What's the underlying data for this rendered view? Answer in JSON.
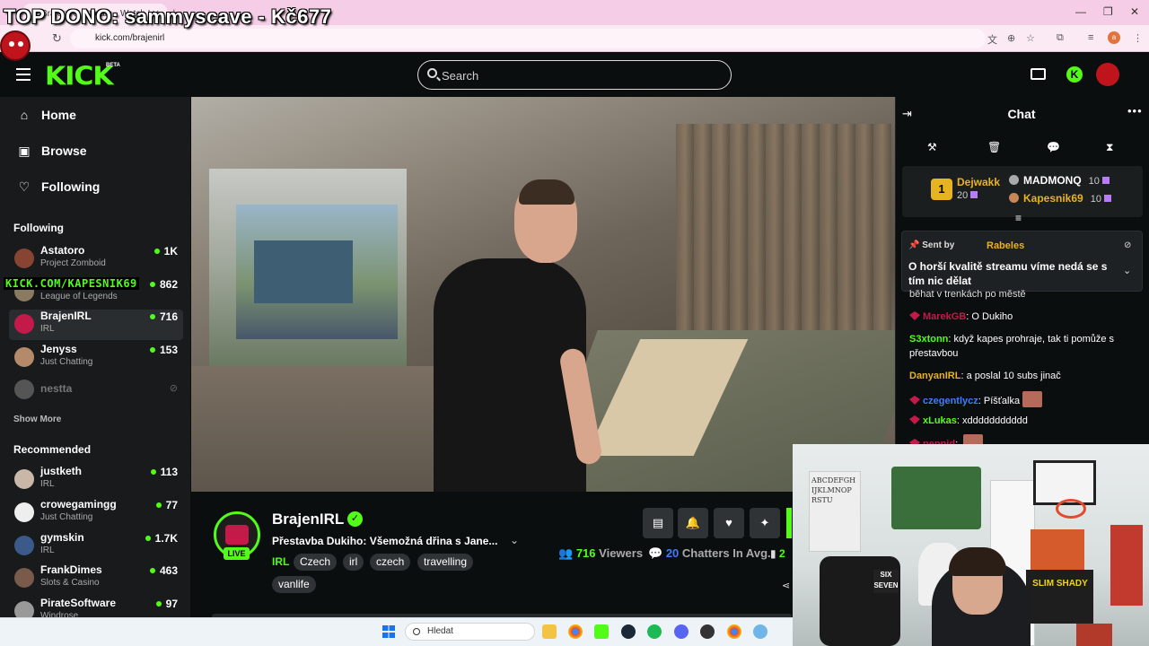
{
  "overlay": {
    "top_donor_text": "TOP DONO: sammyscave - Kč677",
    "watermark": "KICK.COM/KAPESNIK69"
  },
  "browser": {
    "tab_title": "BrajenIRL Stream - Watch L...",
    "url": "kick.com/brajenirl",
    "profile_initial": "a"
  },
  "header": {
    "logo": "KICK",
    "beta": "BETA",
    "search_placeholder": "Search"
  },
  "sidebar": {
    "nav": [
      {
        "label": "Home",
        "icon": "home-icon"
      },
      {
        "label": "Browse",
        "icon": "browse-icon"
      },
      {
        "label": "Following",
        "icon": "heart-icon"
      }
    ],
    "following_heading": "Following",
    "following": [
      {
        "name": "Astatoro",
        "category": "Project Zomboid",
        "viewers": "1K"
      },
      {
        "name": "",
        "category": "League of Legends",
        "viewers": "862"
      },
      {
        "name": "BrajenIRL",
        "category": "IRL",
        "viewers": "716"
      },
      {
        "name": "Jenyss",
        "category": "Just Chatting",
        "viewers": "153"
      },
      {
        "name": "nestta",
        "category": "",
        "viewers": ""
      }
    ],
    "show_more": "Show More",
    "recommended_heading": "Recommended",
    "recommended": [
      {
        "name": "justketh",
        "category": "IRL",
        "viewers": "113"
      },
      {
        "name": "crowegamingg",
        "category": "Just Chatting",
        "viewers": "77"
      },
      {
        "name": "gymskin",
        "category": "IRL",
        "viewers": "1.7K"
      },
      {
        "name": "FrankDimes",
        "category": "Slots & Casino",
        "viewers": "463"
      },
      {
        "name": "PirateSoftware",
        "category": "Windrose",
        "viewers": "97"
      }
    ]
  },
  "stream": {
    "channel": "BrajenIRL",
    "live": "LIVE",
    "title": "Přestavba Dukiho: Všemožná dřina s Jane...",
    "category": "IRL",
    "tags": [
      "Czech",
      "irl",
      "czech",
      "travelling",
      "vanlife"
    ],
    "viewers_value": "716",
    "viewers_label": "Viewers",
    "chatters_value": "20",
    "chatters_label": "Chatters In Avg.",
    "stat_partial": "2"
  },
  "chat": {
    "title": "Chat",
    "leaderboard": {
      "first_rank": "1",
      "first_name": "Dejwakk",
      "first_value": "20",
      "rows": [
        {
          "name": "MADMONQ",
          "value": "10",
          "color": "#ffffff"
        },
        {
          "name": "Kapesnik69",
          "value": "10",
          "color": "#e8b321"
        }
      ]
    },
    "pinned": {
      "sent_by": "Sent by",
      "user": "Rabeles",
      "text": "O horší kvalitě streamu víme nedá se s tím nic dělat"
    },
    "messages": [
      {
        "user": "",
        "user_color": "#ffffff",
        "text": "běhat v trenkách po městě",
        "badge": false
      },
      {
        "user": "MarekGB",
        "user_color": "#c31a4a",
        "text": "O Dukiho",
        "badge": true
      },
      {
        "user": "S3xtonn",
        "user_color": "#53fc18",
        "text": "když kapes prohraje, tak ti pomůže s přestavbou",
        "badge": false
      },
      {
        "user": "DanyanIRL",
        "user_color": "#e8b321",
        "text": "a poslal 10 subs jinač",
        "badge": false
      },
      {
        "user": "czegentlycz",
        "user_color": "#3f7dfb",
        "text": "Píšťalka",
        "badge": true
      },
      {
        "user": "xLukas",
        "user_color": "#53fc18",
        "text": "xddddddddddd",
        "badge": true
      },
      {
        "user": "peppid",
        "user_color": "#c31a4a",
        "text": "",
        "badge": true
      }
    ]
  },
  "webcam": {
    "shirt_text": "SLIM SHADY",
    "sign_text": "SIX SEVEN"
  },
  "taskbar": {
    "search_placeholder": "Hledat"
  },
  "colors": {
    "kick_green": "#53fc18",
    "bg": "#0b0e0f",
    "sidebar_bg": "#181a1b"
  }
}
